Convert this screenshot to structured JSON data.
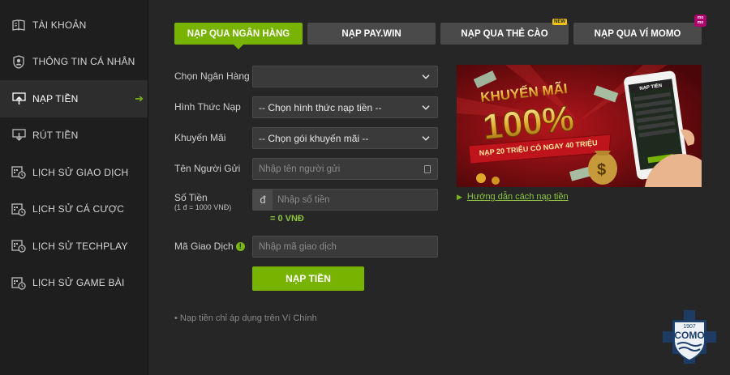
{
  "sidebar": {
    "items": [
      {
        "label": "TÀI KHOẢN",
        "icon": "book-icon",
        "active": false
      },
      {
        "label": "THÔNG TIN CÁ NHÂN",
        "icon": "user-id-icon",
        "active": false
      },
      {
        "label": "NẠP TIỀN",
        "icon": "deposit-icon",
        "active": true
      },
      {
        "label": "RÚT TIỀN",
        "icon": "withdraw-icon",
        "active": false
      },
      {
        "label": "LỊCH SỬ GIAO DỊCH",
        "icon": "calendar-clock-icon",
        "active": false
      },
      {
        "label": "LỊCH SỬ CÁ CƯỢC",
        "icon": "calendar-clock-icon",
        "active": false
      },
      {
        "label": "LỊCH SỬ TECHPLAY",
        "icon": "calendar-clock-icon",
        "active": false
      },
      {
        "label": "LỊCH SỬ GAME BÀI",
        "icon": "calendar-clock-icon",
        "active": false
      }
    ]
  },
  "tabs": [
    {
      "label": "NẠP QUA NGÂN HÀNG",
      "active": true
    },
    {
      "label": "NẠP PAY.WIN",
      "active": false
    },
    {
      "label": "NẠP QUA THẺ CÀO",
      "active": false,
      "badge": "NEW"
    },
    {
      "label": "NẠP QUA VÍ MOMO",
      "active": false,
      "badge": "mo mo"
    }
  ],
  "form": {
    "bank_label": "Chọn Ngân Hàng",
    "bank_value": "",
    "method_label": "Hình Thức Nạp",
    "method_value": "-- Chọn hình thức nạp tiền --",
    "promo_label": "Khuyến Mãi",
    "promo_value": "-- Chọn gói khuyến mãi --",
    "sender_label": "Tên Người Gửi",
    "sender_placeholder": "Nhập tên người gửi",
    "amount_label": "Số Tiền",
    "amount_hint": "(1 đ = 1000 VNĐ)",
    "currency_symbol": "đ",
    "amount_placeholder": "Nhập số tiền",
    "amount_total": "= 0 VNĐ",
    "txn_label": "Mã Giao Dịch",
    "txn_placeholder": "Nhập mã giao dịch",
    "submit_label": "NẠP TIỀN",
    "note": "• Nạp tiền chỉ áp dụng trên Ví Chính"
  },
  "banner": {
    "headline": "KHUYẾN MÃI",
    "percent": "100%",
    "ribbon": "NẠP 20 TRIỆU CÓ NGAY 40 TRIỆU",
    "phone_title": "NẠP TIỀN"
  },
  "guide_link": "Hướng dẫn cách nạp tiền",
  "logo": {
    "year": "1907",
    "name": "COMO"
  },
  "colors": {
    "accent": "#77b300",
    "sidebar": "#1e1e1e",
    "panel": "#262626",
    "field": "#3a3a3a",
    "tab_inactive": "#4a4a4a"
  }
}
